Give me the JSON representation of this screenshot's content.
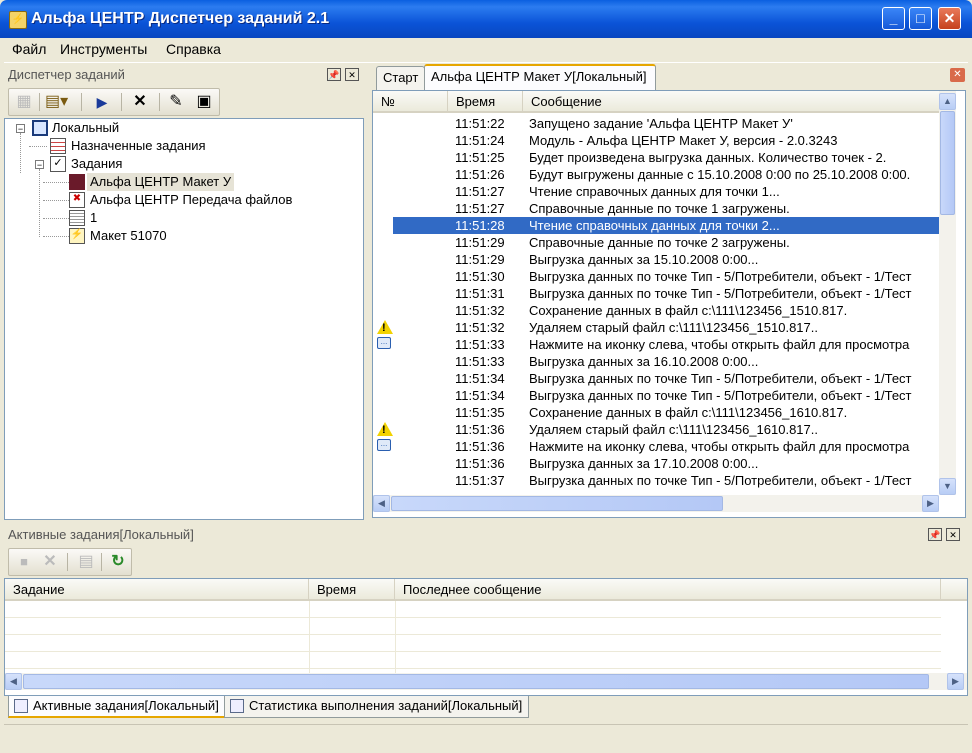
{
  "window": {
    "title": "Альфа ЦЕНТР Диспетчер заданий 2.1",
    "minimize": "_",
    "maximize": "□",
    "close": "✕"
  },
  "menu": {
    "items": [
      "Файл",
      "Инструменты",
      "Справка"
    ]
  },
  "task_panel": {
    "title": "Диспетчер заданий",
    "pin": "📌",
    "close": "✕",
    "tree": {
      "root": "Локальный",
      "assigned": "Назначенные задания",
      "tasks_folder": "Задания",
      "children": [
        "Альфа ЦЕНТР Макет У",
        "Альфа ЦЕНТР Передача файлов",
        "1",
        "Макет 51070"
      ]
    }
  },
  "tabs": {
    "start": "Старт",
    "active": "Альфа ЦЕНТР Макет У[Локальный]",
    "close": "✕"
  },
  "log": {
    "columns": [
      "№",
      "Время",
      "Сообщение"
    ],
    "rows": [
      {
        "icon": "",
        "time": "11:51:22",
        "msg": "Запущено задание 'Альфа ЦЕНТР Макет У'"
      },
      {
        "icon": "",
        "time": "11:51:24",
        "msg": "Модуль - Альфа ЦЕНТР Макет У, версия - 2.0.3243"
      },
      {
        "icon": "",
        "time": "11:51:25",
        "msg": "Будет произведена выгрузка данных. Количество точек  - 2."
      },
      {
        "icon": "",
        "time": "11:51:26",
        "msg": "Будут выгружены данные с 15.10.2008 0:00 по 25.10.2008 0:00."
      },
      {
        "icon": "",
        "time": "11:51:27",
        "msg": "Чтение справочных данных для точки 1..."
      },
      {
        "icon": "",
        "time": "11:51:27",
        "msg": "Справочные данные по точке 1 загружены."
      },
      {
        "icon": "",
        "time": "11:51:28",
        "msg": "Чтение справочных данных для точки 2...",
        "selected": true
      },
      {
        "icon": "",
        "time": "11:51:29",
        "msg": "Справочные данные по точке 2 загружены."
      },
      {
        "icon": "",
        "time": "11:51:29",
        "msg": "Выгрузка данных за 15.10.2008 0:00..."
      },
      {
        "icon": "",
        "time": "11:51:30",
        "msg": "Выгрузка данных по точке Тип - 5/Потребители, объект - 1/Тест"
      },
      {
        "icon": "",
        "time": "11:51:31",
        "msg": "Выгрузка данных по точке Тип - 5/Потребители, объект - 1/Тест"
      },
      {
        "icon": "",
        "time": "11:51:32",
        "msg": "Сохранение данных в файл c:\\111\\123456_1510.817."
      },
      {
        "icon": "warning",
        "time": "11:51:32",
        "msg": "Удаляем старый файл c:\\111\\123456_1510.817.."
      },
      {
        "icon": "file",
        "time": "11:51:33",
        "msg": "Нажмите на иконку слева, чтобы открыть файл для просмотра"
      },
      {
        "icon": "",
        "time": "11:51:33",
        "msg": "Выгрузка данных за 16.10.2008 0:00..."
      },
      {
        "icon": "",
        "time": "11:51:34",
        "msg": "Выгрузка данных по точке Тип - 5/Потребители, объект - 1/Тест"
      },
      {
        "icon": "",
        "time": "11:51:34",
        "msg": "Выгрузка данных по точке Тип - 5/Потребители, объект - 1/Тест"
      },
      {
        "icon": "",
        "time": "11:51:35",
        "msg": "Сохранение данных в файл c:\\111\\123456_1610.817."
      },
      {
        "icon": "warning",
        "time": "11:51:36",
        "msg": "Удаляем старый файл c:\\111\\123456_1610.817.."
      },
      {
        "icon": "file",
        "time": "11:51:36",
        "msg": "Нажмите на иконку слева, чтобы открыть файл для просмотра"
      },
      {
        "icon": "",
        "time": "11:51:36",
        "msg": "Выгрузка данных за 17.10.2008 0:00..."
      },
      {
        "icon": "",
        "time": "11:51:37",
        "msg": "Выгрузка данных по точке Тип - 5/Потребители, объект - 1/Тест"
      }
    ]
  },
  "active_panel": {
    "title": "Активные задания[Локальный]",
    "pin": "📌",
    "close": "✕",
    "columns": [
      "Задание",
      "Время",
      "Последнее сообщение"
    ]
  },
  "bottom_tabs": [
    "Активные задания[Локальный]",
    "Статистика выполнения заданий[Локальный]"
  ],
  "colors": {
    "selection": "#316ac5",
    "titlebar": "#0a5fe0",
    "accent_tab": "#e6a600"
  }
}
